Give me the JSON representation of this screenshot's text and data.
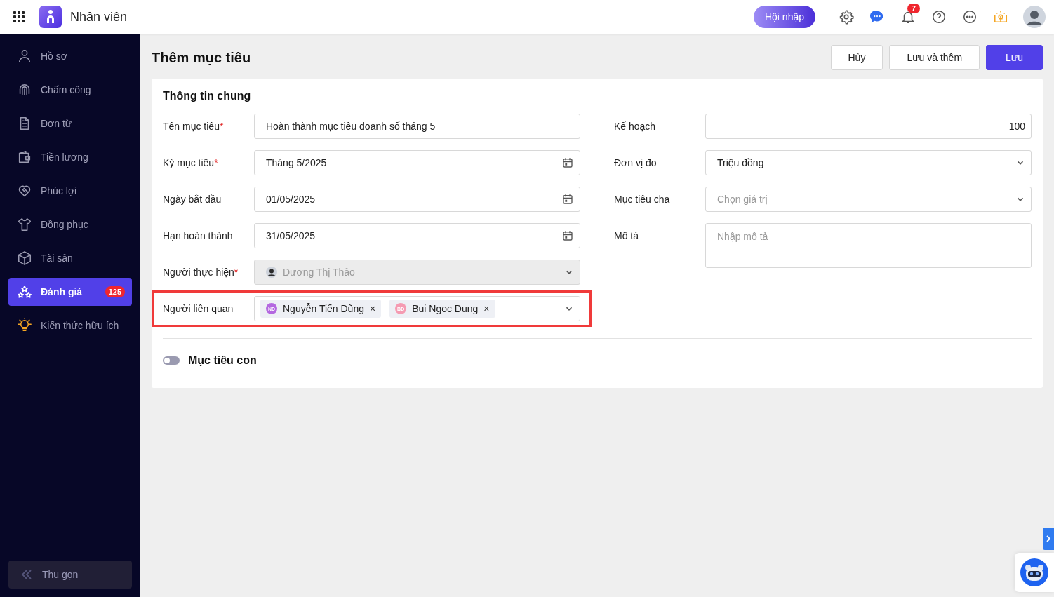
{
  "header": {
    "app_title": "Nhân viên",
    "join_button": "Hội nhập",
    "notification_count": "7"
  },
  "sidebar": {
    "items": [
      {
        "label": "Hồ sơ",
        "selected": false
      },
      {
        "label": "Chấm công",
        "selected": false
      },
      {
        "label": "Đơn từ",
        "selected": false
      },
      {
        "label": "Tiền lương",
        "selected": false
      },
      {
        "label": "Phúc lợi",
        "selected": false
      },
      {
        "label": "Đồng phục",
        "selected": false
      },
      {
        "label": "Tài sản",
        "selected": false
      },
      {
        "label": "Đánh giá",
        "selected": true,
        "badge": "125"
      },
      {
        "label": "Kiến thức hữu ích",
        "selected": false
      }
    ],
    "collapse": "Thu gọn"
  },
  "page": {
    "title": "Thêm mục tiêu",
    "buttons": [
      {
        "label": "Hủy",
        "kind": "secondary"
      },
      {
        "label": "Lưu và thêm",
        "kind": "secondary"
      },
      {
        "label": "Lưu",
        "kind": "primary"
      }
    ]
  },
  "section": {
    "title": "Thông tin chung",
    "left_fields": [
      {
        "label": "Tên mục tiêu",
        "mark": "*",
        "kind": "text",
        "value": "Hoàn thành mục tiêu doanh số tháng 5",
        "highlighted": false
      },
      {
        "label": "Kỳ mục tiêu",
        "mark": "*",
        "kind": "date",
        "value": "Tháng 5/2025",
        "highlighted": false
      },
      {
        "label": "Ngày bắt đầu",
        "kind": "date",
        "value": "01/05/2025",
        "highlighted": false
      },
      {
        "label": "Hạn hoàn thành",
        "kind": "date",
        "value": "31/05/2025",
        "highlighted": false
      },
      {
        "label": "Người thực hiện",
        "mark": "*",
        "kind": "person",
        "value": "Dương Thị Thảo",
        "disabled": true,
        "highlighted": false
      },
      {
        "label": "Người liên quan",
        "kind": "tags",
        "highlighted": true,
        "tags": [
          {
            "initials": "ND",
            "name": "Nguyễn Tiến Dũng",
            "remove": "×",
            "color": "#b468e0"
          },
          {
            "initials": "BD",
            "name": "Bui Ngoc Dung",
            "remove": "×",
            "color": "#f59bb2"
          }
        ]
      }
    ],
    "right_fields": [
      {
        "label": "Kế hoạch",
        "kind": "number",
        "value": "100"
      },
      {
        "label": "Đơn vị đo",
        "kind": "select",
        "value": "Triệu đồng"
      },
      {
        "label": "Mục tiêu cha",
        "kind": "select",
        "placeholder": "Chọn giá trị"
      },
      {
        "label": "Mô tả",
        "kind": "textarea",
        "placeholder": "Nhập mô tả"
      }
    ],
    "subgoal_toggle": {
      "label": "Mục tiêu con",
      "on": false
    }
  }
}
